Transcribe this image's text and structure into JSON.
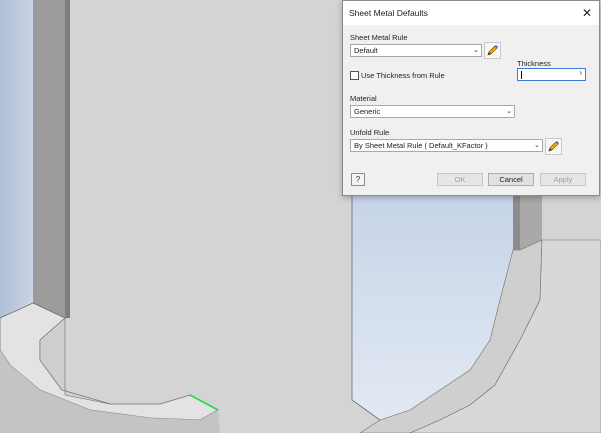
{
  "dialog": {
    "title": "Sheet Metal Defaults",
    "sheet_metal_rule_label": "Sheet Metal Rule",
    "sheet_metal_rule_value": "Default",
    "thickness_label": "Thickness",
    "thickness_value": "",
    "use_thickness_label": "Use Thickness from Rule",
    "use_thickness_checked": false,
    "material_label": "Material",
    "material_value": "Generic",
    "unfold_rule_label": "Unfold Rule",
    "unfold_rule_value": "By Sheet Metal Rule ( Default_KFactor )",
    "ok_label": "OK",
    "cancel_label": "Cancel",
    "apply_label": "Apply"
  },
  "colors": {
    "viewport_background": "#d4d4d4",
    "sky_gradient_light": "#dde6f2",
    "sky_gradient_dark": "#aebfd6",
    "edge_highlight": "#22dd44",
    "input_focus_border": "#3b7ddd"
  },
  "icons": {
    "edit_rule": "pencil-icon",
    "edit_unfold_rule": "pencil-icon",
    "help": "help-icon",
    "close": "close-icon",
    "dropdown": "chevron-down-icon"
  }
}
